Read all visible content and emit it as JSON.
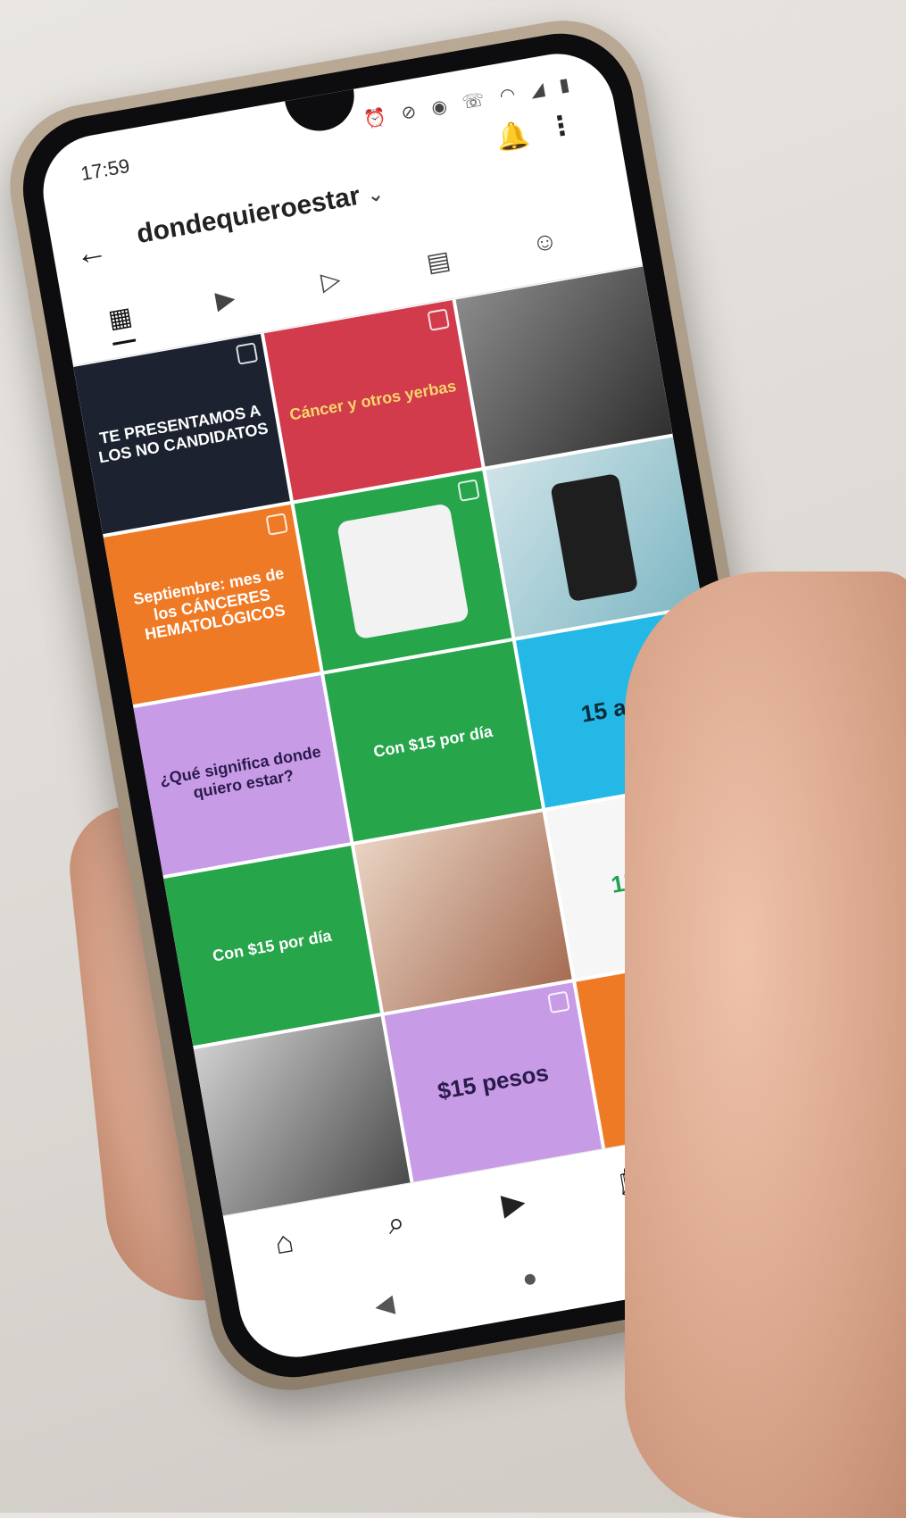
{
  "status": {
    "time": "17:59"
  },
  "header": {
    "username": "dondequieroestar"
  },
  "icons": {
    "back": "←",
    "chevron": "⌄",
    "bell": "🔔",
    "more": "⋮",
    "grid": "▦",
    "reels": "▶",
    "play": "▷",
    "guide": "▤",
    "tagged": "☺",
    "home": "⌂",
    "search": "⌕",
    "reels_nav": "▶",
    "shop": "🛍",
    "sys_back": "◀",
    "sys_home": "●",
    "sys_recent": "■"
  },
  "tiles": {
    "t1": "TE PRESENTAMOS A LOS NO CANDIDATOS",
    "t2": "Cáncer y otros yerbas",
    "t4": "Septiembre: mes de los CÁNCERES HEMATOLÓGICOS",
    "t7": "¿Qué significa donde quiero estar?",
    "t8": "Con $15 por día",
    "t9": "15 años",
    "t10": "Con $15 por día",
    "t12": "15 años",
    "t14": "$15 pesos"
  },
  "colors": {
    "orange": "#ef7a26",
    "green": "#26a54a",
    "purple": "#c89be7",
    "cyan": "#23b8e6",
    "red": "#d23b4c"
  }
}
